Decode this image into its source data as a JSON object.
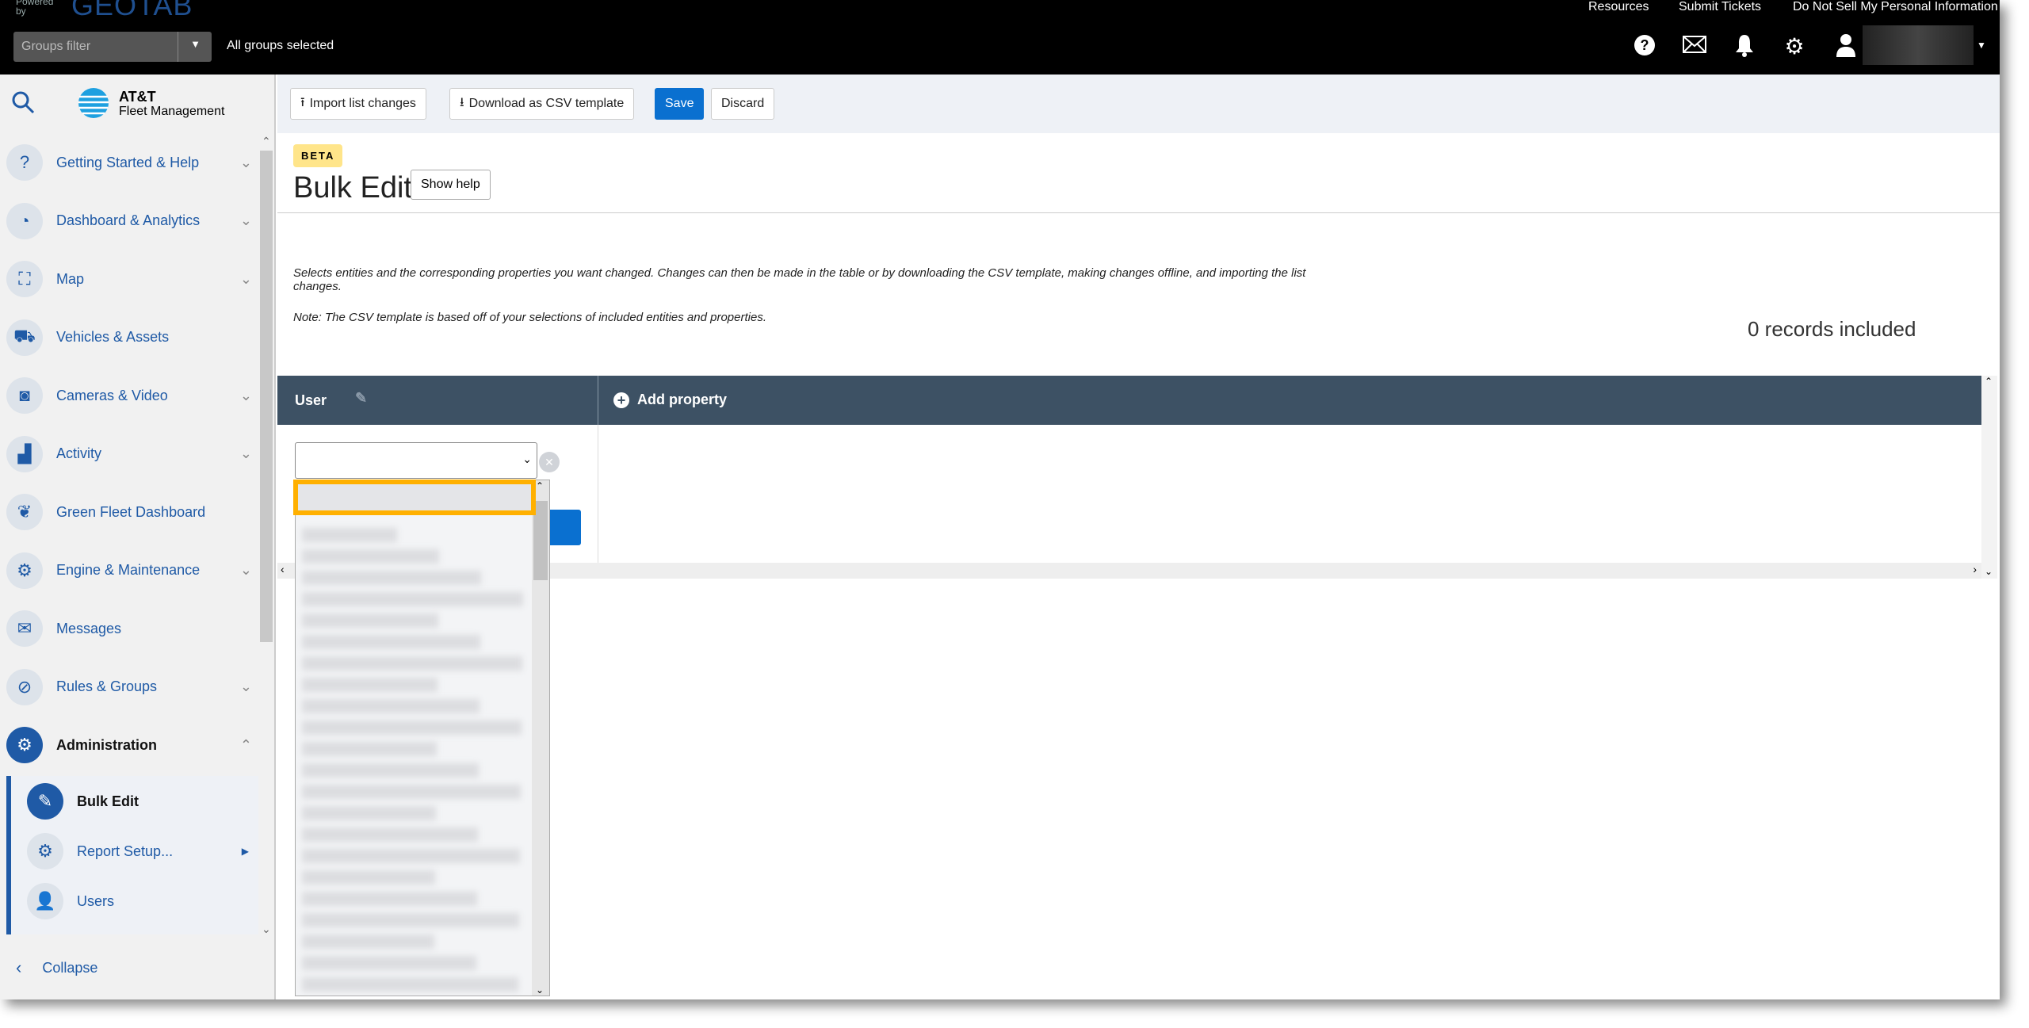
{
  "header": {
    "powered_by": "Powered by",
    "brand": "GEOTAB",
    "groups_filter_placeholder": "Groups filter",
    "groups_status": "All groups selected",
    "links": [
      "Resources",
      "Submit Tickets",
      "Do Not Sell My Personal Information"
    ]
  },
  "sidebar": {
    "logo_line1": "AT&T",
    "logo_line2": "Fleet Management",
    "items": [
      {
        "label": "Getting Started & Help",
        "icon": "help-icon"
      },
      {
        "label": "Dashboard & Analytics",
        "icon": "pie-chart-icon"
      },
      {
        "label": "Map",
        "icon": "map-icon"
      },
      {
        "label": "Vehicles & Assets",
        "icon": "truck-icon"
      },
      {
        "label": "Cameras & Video",
        "icon": "camera-icon"
      },
      {
        "label": "Activity",
        "icon": "chart-icon"
      },
      {
        "label": "Green Fleet Dashboard",
        "icon": "leaf-icon"
      },
      {
        "label": "Engine & Maintenance",
        "icon": "engine-icon"
      },
      {
        "label": "Messages",
        "icon": "mail-icon"
      },
      {
        "label": "Rules & Groups",
        "icon": "rules-icon"
      },
      {
        "label": "Administration",
        "icon": "gear-icon"
      }
    ],
    "subitems": [
      {
        "label": "Bulk Edit"
      },
      {
        "label": "Report Setup..."
      },
      {
        "label": "Users"
      }
    ],
    "collapse": "Collapse"
  },
  "toolbar": {
    "import": "Import list changes",
    "download": "Download as CSV template",
    "save": "Save",
    "discard": "Discard"
  },
  "page": {
    "badge": "BETA",
    "title": "Bulk Edit",
    "show_help": "Show help",
    "description": "Selects entities and the corresponding properties you want changed. Changes can then be made in the table or by downloading the CSV template, making changes offline, and importing the list changes.",
    "note": "Note: The CSV template is based off of your selections of included entities and properties.",
    "records": "0 records included"
  },
  "table": {
    "col_user": "User",
    "add_property": "Add property"
  },
  "colors": {
    "accent": "#0a70d0",
    "header": "#3d5164",
    "highlight": "#ffb000"
  }
}
